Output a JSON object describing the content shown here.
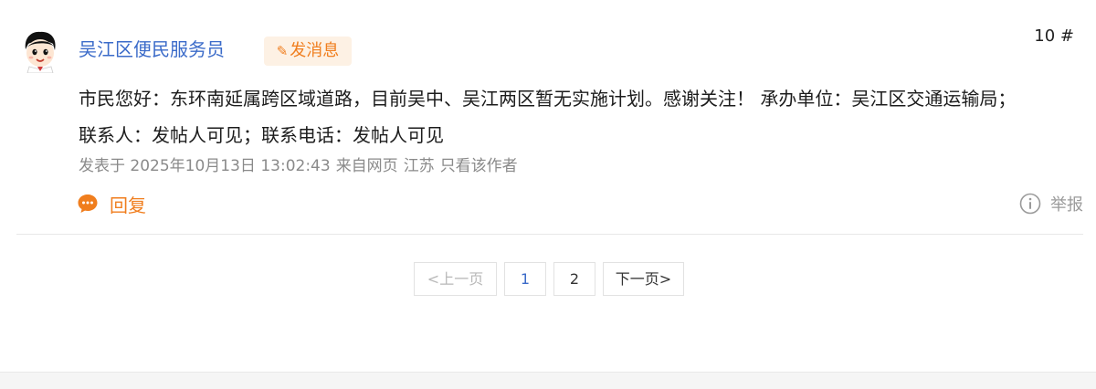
{
  "post": {
    "author": "吴江区便民服务员",
    "message_button": "发消息",
    "message_icon": "pencil-icon",
    "floor": "10 #",
    "content_line1": "市民您好：东环南延属跨区域道路，目前吴中、吴江两区暂无实施计划。感谢关注！ 承办单位：吴江区交通运输局；",
    "content_line2": "联系人：发帖人可见；联系电话：发帖人可见",
    "meta": {
      "posted_at": "发表于 2025年10月13日 13:02:43",
      "source": "来自网页",
      "location": "江苏",
      "only_author": "只看该作者"
    },
    "reply_label": "回复",
    "report_label": "举报"
  },
  "pagination": {
    "prev": "<上一页",
    "pages": [
      "1",
      "2"
    ],
    "current": "1",
    "next": "下一页>"
  },
  "colors": {
    "author": "#3b6bc9",
    "accent_orange": "#f07e1e",
    "message_bg": "#fdf1e4",
    "meta_gray": "#8a8a8a"
  }
}
